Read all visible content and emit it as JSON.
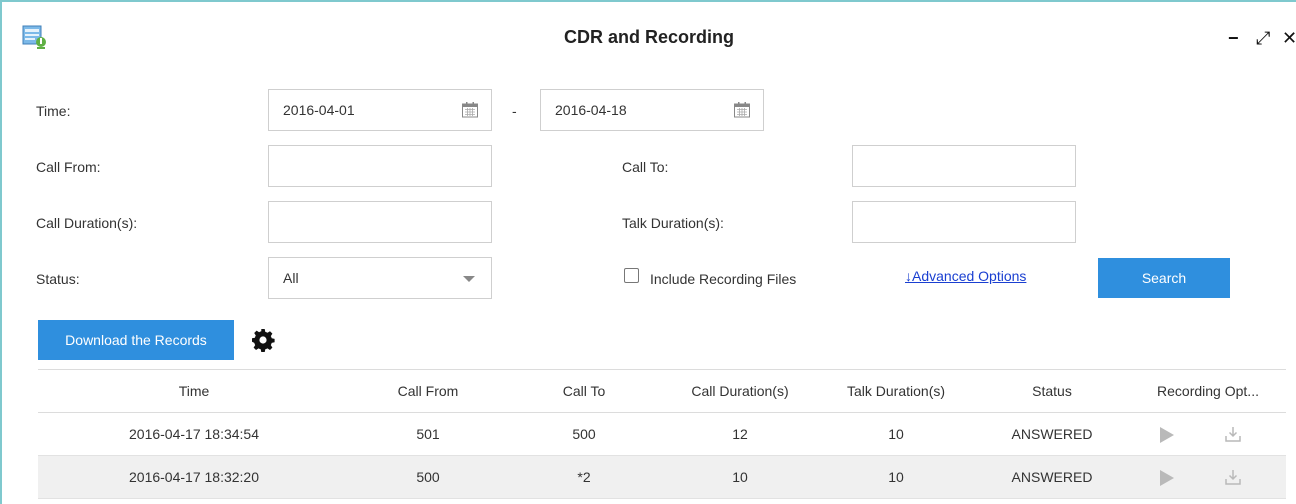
{
  "window": {
    "title": "CDR and Recording",
    "controls": {
      "minimize": "−",
      "maximize": "⤢",
      "close": "✕"
    }
  },
  "filters": {
    "time_label": "Time:",
    "time_from": "2016-04-01",
    "time_separator": "-",
    "time_to": "2016-04-18",
    "call_from_label": "Call From:",
    "call_from_value": "",
    "call_to_label": "Call To:",
    "call_to_value": "",
    "call_duration_label": "Call Duration(s):",
    "call_duration_value": "",
    "talk_duration_label": "Talk Duration(s):",
    "talk_duration_value": "",
    "status_label": "Status:",
    "status_value": "All",
    "include_recording_label": "Include Recording Files",
    "include_recording_checked": false,
    "advanced_options": "↓Advanced Options",
    "search_button": "Search"
  },
  "toolbar": {
    "download_button": "Download the Records"
  },
  "table": {
    "columns": [
      "Time",
      "Call From",
      "Call To",
      "Call Duration(s)",
      "Talk Duration(s)",
      "Status",
      "Recording Opt..."
    ],
    "rows": [
      {
        "time": "2016-04-17 18:34:54",
        "call_from": "501",
        "call_to": "500",
        "call_duration": "12",
        "talk_duration": "10",
        "status": "ANSWERED"
      },
      {
        "time": "2016-04-17 18:32:20",
        "call_from": "500",
        "call_to": "*2",
        "call_duration": "10",
        "talk_duration": "10",
        "status": "ANSWERED"
      }
    ]
  },
  "colors": {
    "accent": "#2f8fde",
    "link": "#1a3fd1",
    "window_border": "#7fc9ce",
    "alt_row": "#f0f0f0"
  }
}
